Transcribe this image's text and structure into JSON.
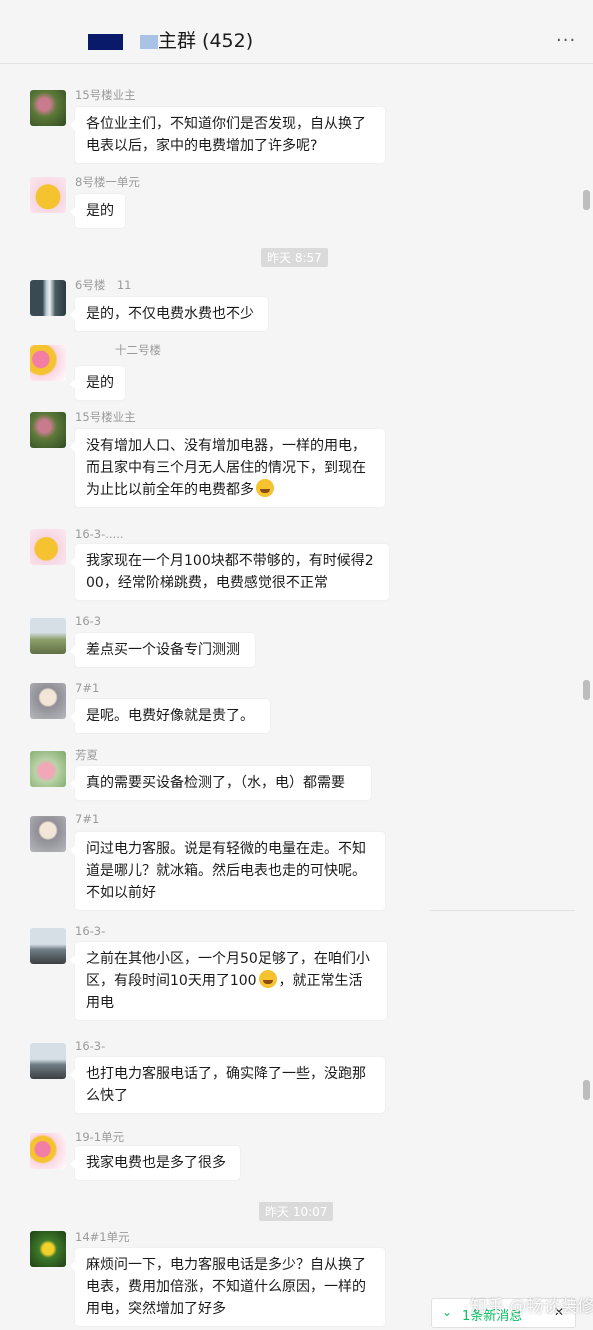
{
  "window": {
    "pin_icon": "pin-icon",
    "minimize_icon": "minimize-icon",
    "maximize_icon": "maximize-icon",
    "close_icon": "close-icon",
    "pin_glyph": "⊥",
    "minimize_glyph": "—",
    "maximize_glyph": "□",
    "close_glyph": "✕"
  },
  "header": {
    "title": "主群 (452)",
    "more_glyph": "···"
  },
  "timestamps": [
    "昨天 8:57",
    "昨天 10:07"
  ],
  "messages": [
    {
      "sender": "15号楼业主",
      "avatar": "flower-avatar",
      "text": [
        "各位业主们，不知道你们是否发现，自从换了",
        "电表以后，家中的电费增加了许多呢?"
      ]
    },
    {
      "sender": "8号楼一单元",
      "avatar": "emoji-avatar",
      "text": [
        "是的"
      ]
    },
    {
      "sender": "6号楼　11",
      "avatar": "waterfall-avatar",
      "text": [
        "是的，不仅电费水费也不少"
      ]
    },
    {
      "sender": "十二号楼",
      "avatar": "hearts-avatar",
      "text": [
        "是的"
      ]
    },
    {
      "sender": "15号楼业主",
      "avatar": "flower-avatar",
      "text": [
        "没有增加人口、没有增加电器，一样的用电，",
        "而且家中有三个月无人居住的情况下，到现在",
        "为止比以前全年的电费都多"
      ]
    },
    {
      "sender": "16-3-.....",
      "avatar": "emoji-avatar",
      "text": [
        "我家现在一个月100块都不带够的，有时候得2",
        "00，经常阶梯跳费，电费感觉很不正常"
      ]
    },
    {
      "sender": "16-3",
      "avatar": "road-avatar",
      "text": [
        "差点买一个设备专门测测"
      ]
    },
    {
      "sender": "7#1",
      "avatar": "anime-avatar",
      "text": [
        "是呢。电费好像就是贵了。"
      ]
    },
    {
      "sender": "芳夏",
      "avatar": "lotus-avatar",
      "text": [
        "真的需要买设备检测了，（水，电）都需要"
      ]
    },
    {
      "sender": "7#1",
      "avatar": "anime-avatar",
      "text": [
        "问过电力客服。说是有轻微的电量在走。不知",
        "道是哪儿？就冰箱。然后电表也走的可快呢。",
        "不如以前好"
      ]
    },
    {
      "sender": "16-3-",
      "avatar": "road-avatar",
      "text": [
        "之前在其他小区，一个月50足够了，在咱们小",
        "区，有段时间10天用了100",
        "用电"
      ]
    },
    {
      "sender": "16-3-",
      "avatar": "road-avatar",
      "text": [
        "也打电力客服电话了，确实降了一些，没跑那",
        "么快了"
      ]
    },
    {
      "sender": "19-1单元",
      "avatar": "hearts-avatar",
      "text": [
        "我家电费也是多了很多"
      ]
    },
    {
      "sender": "14#1单元",
      "avatar": "yellow-flower-avatar",
      "text": [
        "麻烦问一下，电力客服电话是多少？自从换了",
        "电表，费用加倍涨，不知道什么原因，一样的",
        "用电，突然增加了好多"
      ]
    }
  ],
  "inline_suffix": "，就正常生活",
  "new_messages": {
    "label": "1条新消息",
    "chevron": "⌄",
    "close": "✕"
  },
  "watermark": "知乎 @畅谈装修",
  "colors": {
    "background": "#f5f5f5",
    "bubble": "#ffffff",
    "accent": "#07c160",
    "meta_text": "#9a9a9a"
  }
}
